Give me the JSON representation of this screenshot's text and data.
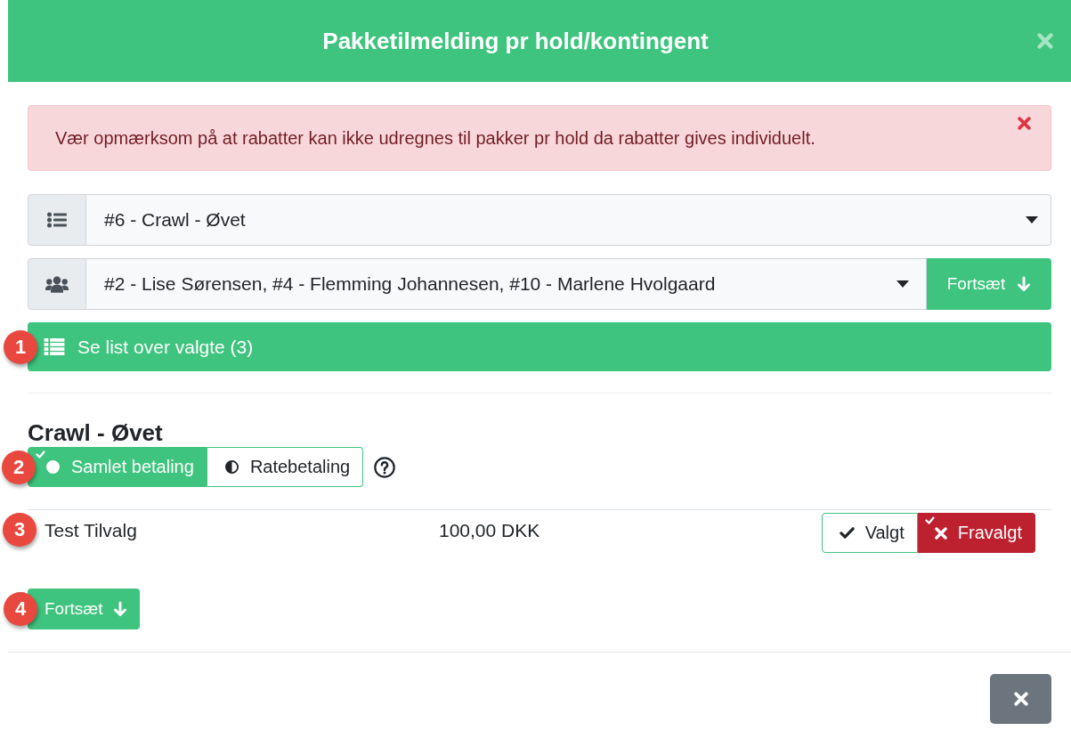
{
  "modal": {
    "title": "Pakketilmelding pr hold/kontingent"
  },
  "alert": {
    "message": "Vær opmærksom på at rabatter kan ikke udregnes til pakker pr hold da rabatter gives individuelt."
  },
  "team_select": {
    "value": "#6 - Crawl - Øvet"
  },
  "members_select": {
    "value": "#2 - Lise Sørensen, #4 - Flemming Johannesen, #10 - Marlene Hvolgaard",
    "button": "Fortsæt"
  },
  "list_button": {
    "label": "Se list over valgte (3)",
    "callout": "1"
  },
  "section": {
    "heading": "Crawl - Øvet",
    "callout": "2",
    "payment_options": [
      {
        "label": "Samlet betaling",
        "kind": "lump",
        "selected": true
      },
      {
        "label": "Ratebetaling",
        "kind": "installment",
        "selected": false
      }
    ]
  },
  "addons": [
    {
      "name": "Test Tilvalg",
      "price": "100,00 DKK",
      "callout": "3",
      "choices": [
        {
          "label": "Valgt",
          "kind": "accept",
          "selected": false
        },
        {
          "label": "Fravalgt",
          "kind": "decline",
          "selected": true
        }
      ]
    }
  ],
  "continue_button": {
    "label": "Fortsæt",
    "callout": "4"
  }
}
